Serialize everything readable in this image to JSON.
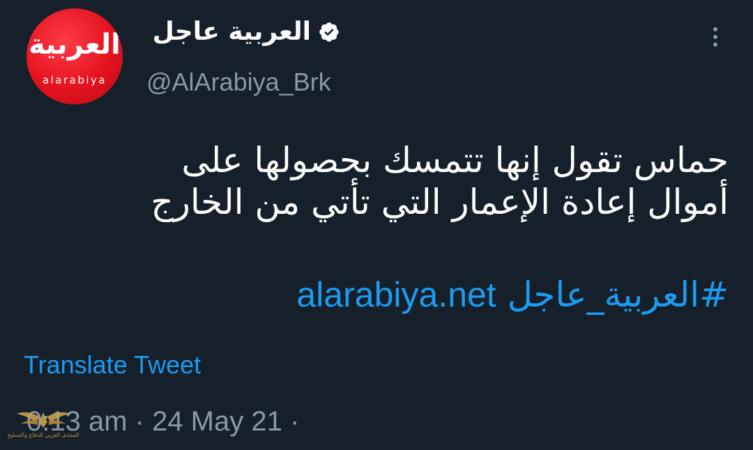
{
  "header": {
    "display_name": "العربية عاجل",
    "handle": "@AlArabiya_Brk",
    "verified_icon": "verified-badge-icon",
    "more_icon": "more-vertical-icon"
  },
  "avatar": {
    "logo_arabic": "العربية",
    "logo_english": "alarabiya",
    "brand_color": "#e3131f"
  },
  "tweet": {
    "text_lines": [
      "حماس تقول إنها تتمسك بحصولها على",
      "أموال إعادة الإعمار التي تأتي من الخارج"
    ],
    "hashtag": "#العربية_عاجل",
    "link": "alarabiya.net",
    "translate_label": "Translate Tweet",
    "timestamp": "0:13 am · 24 May 21 ·"
  },
  "watermark": {
    "text": "المنتدى العربي للدفاع والتسليح"
  },
  "colors": {
    "background": "#15202b",
    "text": "#ffffff",
    "secondary_text": "#8b98a5",
    "link": "#1d9bf0"
  }
}
